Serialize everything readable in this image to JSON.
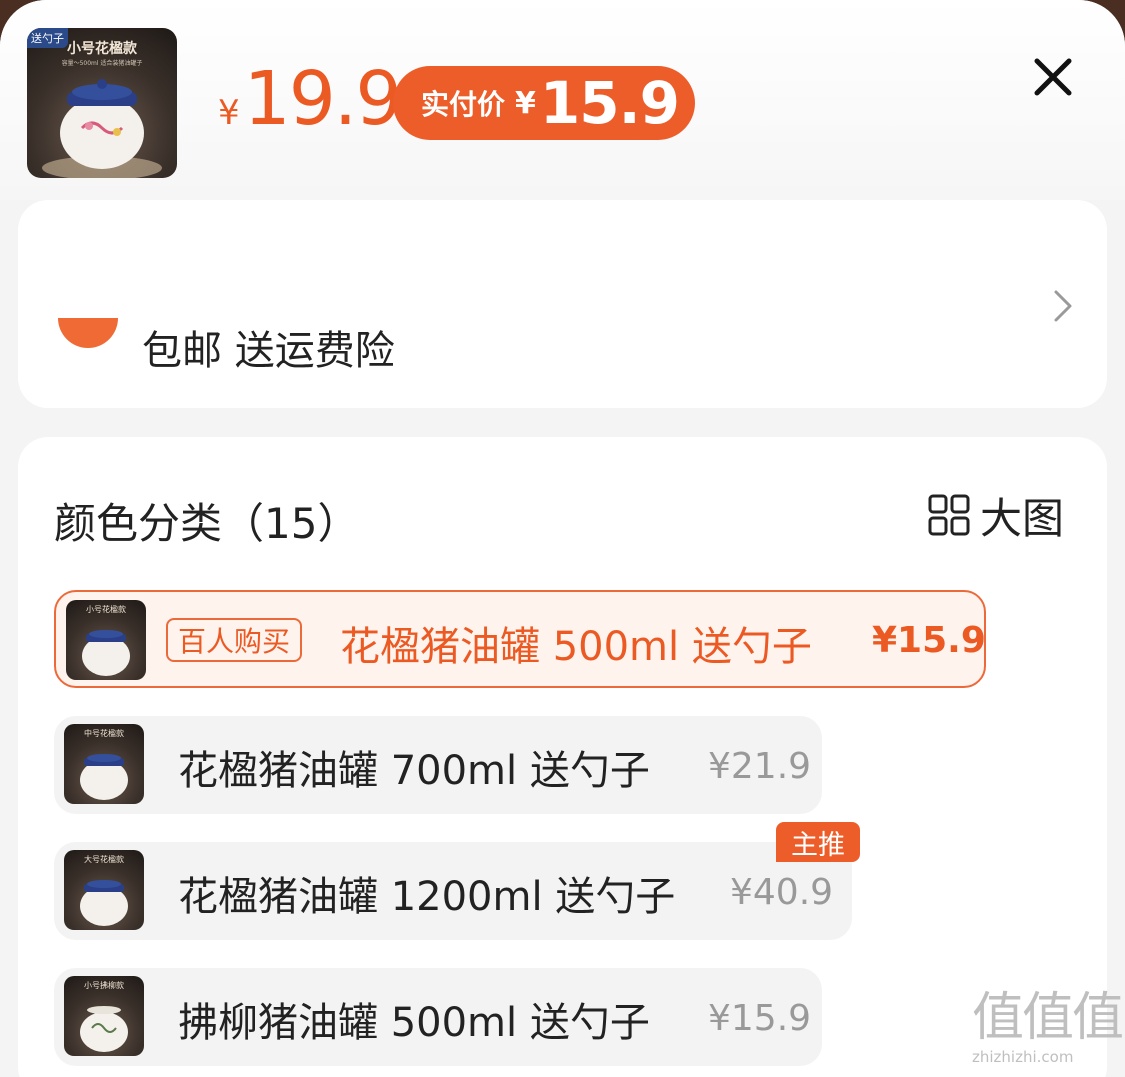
{
  "header": {
    "thumb_tag": "送勺子",
    "thumb_caption": "小号花楹款",
    "thumb_sub": "容量～500ml 适合装猪油罐子",
    "price_yen": "¥",
    "price_value": "19.9",
    "pay_label": "实付价",
    "pay_yen": "¥",
    "pay_value": "15.9",
    "close_icon": "close-icon"
  },
  "shipping": {
    "text": "包邮 送运费险",
    "chevron_icon": "chevron-right-icon"
  },
  "variants": {
    "title": "颜色分类（15）",
    "big_view_label": "大图",
    "big_view_icon": "grid-icon",
    "badge_hundred": "百人购买",
    "badge_main": "主推",
    "options": [
      {
        "name": "花楹猪油罐 500ml 送勺子",
        "price": "¥15.9",
        "thumb": "小号花楹款"
      },
      {
        "name": "花楹猪油罐 700ml 送勺子",
        "price": "¥21.9",
        "thumb": "中号花楹款"
      },
      {
        "name": "花楹猪油罐 1200ml 送勺子",
        "price": "¥40.9",
        "thumb": "大号花楹款"
      },
      {
        "name": "拂柳猪油罐 500ml 送勺子",
        "price": "¥15.9",
        "thumb": "小号拂柳款"
      }
    ]
  },
  "watermark": {
    "glyphs": "值值值",
    "url": "zhizhizhi.com"
  },
  "colors": {
    "accent": "#ED5D2A",
    "sheet_bg": "#F4F4F4",
    "card_bg": "#FFFFFF"
  }
}
